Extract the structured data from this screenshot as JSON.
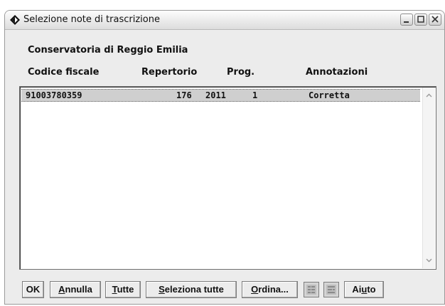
{
  "window": {
    "title": "Selezione note di trascrizione"
  },
  "header": {
    "conservatoria": "Conservatoria di Reggio Emilia",
    "columns": {
      "codice_fiscale": "Codice fiscale",
      "repertorio": "Repertorio",
      "prog": "Prog.",
      "annotazioni": "Annotazioni"
    }
  },
  "list": {
    "rows": [
      {
        "codice_fiscale": "91003780359",
        "repertorio_num": "176",
        "repertorio_anno": "2011",
        "prog": "1",
        "annotazioni": "Corretta"
      }
    ]
  },
  "buttons": {
    "ok": "OK",
    "annulla": {
      "first": "A",
      "rest": "nnulla"
    },
    "tutte": {
      "first": "T",
      "rest": "utte"
    },
    "seleziona_tutte": {
      "first": "S",
      "rest": "eleziona tutte"
    },
    "ordina": {
      "first": "O",
      "rest": "rdina..."
    },
    "aiuto": {
      "pre": "Ai",
      "mid": "u",
      "post": "to"
    }
  },
  "icons": {
    "app": "diamond-app-icon",
    "sort_asc": "sort-ascending-icon",
    "sort_desc": "sort-descending-icon"
  }
}
